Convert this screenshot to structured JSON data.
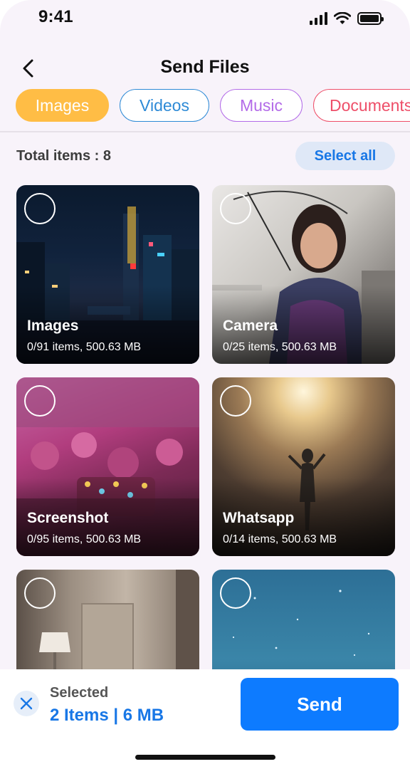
{
  "status_bar": {
    "time": "9:41"
  },
  "header": {
    "title": "Send Files",
    "back_icon": "chevron-left-icon"
  },
  "tabs": [
    {
      "label": "Images",
      "color": "#ffbd45",
      "active": true
    },
    {
      "label": "Videos",
      "color": "#2d8ad6",
      "active": false
    },
    {
      "label": "Music",
      "color": "#b36be8",
      "active": false
    },
    {
      "label": "Documents",
      "color": "#ee4e68",
      "active": false
    }
  ],
  "summary": {
    "total_label": "Total items : 8",
    "select_all_label": "Select all"
  },
  "folders": [
    {
      "name": "Images",
      "meta": "0/91 items, 500.63 MB",
      "selected": false
    },
    {
      "name": "Camera",
      "meta": "0/25 items, 500.63 MB",
      "selected": false
    },
    {
      "name": "Screenshot",
      "meta": "0/95 items, 500.63 MB",
      "selected": false
    },
    {
      "name": "Whatsapp",
      "meta": "0/14 items, 500.63 MB",
      "selected": false
    },
    {
      "name": "",
      "meta": "",
      "selected": false
    },
    {
      "name": "",
      "meta": "",
      "selected": false
    }
  ],
  "selection": {
    "label": "Selected",
    "value": "2 Items | 6 MB",
    "clear_icon": "close-icon",
    "send_label": "Send"
  },
  "colors": {
    "accent": "#0d7bff",
    "link": "#1877e6",
    "background": "#f8f3fa"
  }
}
